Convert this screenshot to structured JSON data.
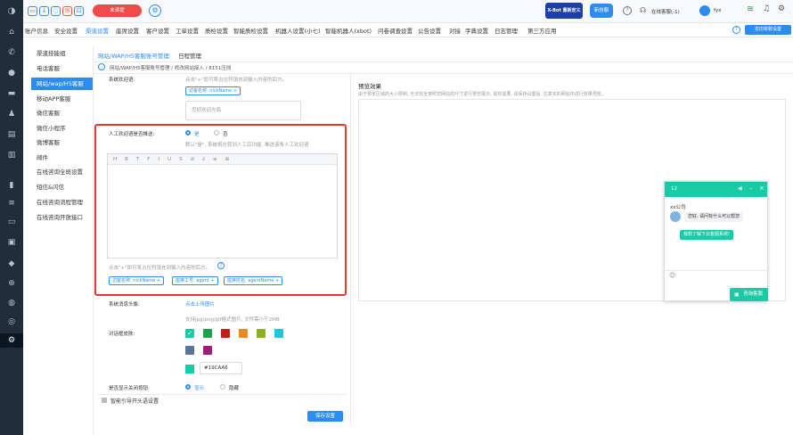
{
  "topbar": {
    "pill_button": "未读提",
    "promo_banner": "X-Bot 重新定义",
    "new_ver": "新技服",
    "status": "在线客服(-1)",
    "user": "fyx"
  },
  "nav": {
    "items": [
      "账户信息",
      "安全设置",
      "渠道设置",
      "座席设置",
      "客户设置",
      "工单设置",
      "质检设置",
      "智能质检设置",
      "机器人设置(小七)",
      "智能机器人(xbot)",
      "问卷调查设置",
      "公告设置",
      "对接",
      "字典设置",
      "日志管理",
      "第三方应用"
    ],
    "active_index": 2,
    "old_version": "去旧单致设置"
  },
  "sidebar": {
    "items": [
      "渠道技能组",
      "电话客服",
      "网站/wap/H5客服",
      "移动APP客服",
      "微信客服",
      "微信小程序",
      "微博客服",
      "邮件",
      "在线咨询全局设置",
      "短信&闪信",
      "在线咨询流程管理",
      "在线咨询开放接口"
    ],
    "active_index": 2
  },
  "tabs": [
    "网站/WAP/H5客服账号管理",
    "日程管理"
  ],
  "breadcrumb": "网站/WAP/H5客服账号管理 / 修改网站接入 / 8151压测",
  "form": {
    "greeting_label": "系统欢迎语:",
    "greeting_hint": "点击\"+\"即可将占位符填充到输入内容的后方。",
    "greeting_tag": "访客名称: nickName",
    "greeting_placeholder": "您好欢迎光临",
    "manual_label": "人工欢迎语是否推送:",
    "manual_yes": "是",
    "manual_no": "否",
    "manual_desc": "默认\"是\", 系统将在转到人工后功能, 推送该条人工欢迎语",
    "editor_hint": "点击\"+\"即可将占位符填充到输入内容的后方。",
    "tags": [
      "访客名称: nickName",
      "座席工号: agent",
      "座席姓名: agentName"
    ],
    "avatar_label": "系统消息头像:",
    "avatar_link": "点击上传图片",
    "avatar_hint": "支持jpg/png/gif格式图片, 文件需小于2MB",
    "skin_label": "对话框皮肤:",
    "skin_colors": [
      "#19CAA6",
      "#1aa34a",
      "#c0201a",
      "#e6891e",
      "#8bb21d",
      "#20c5d8",
      "#5a7598",
      "#a01a7c"
    ],
    "skin_value": "#19CAA6",
    "close_label": "是否显示关闭按钮:",
    "close_show": "显示",
    "close_hide": "隐藏",
    "section_bottom": "智能引导开头语设置",
    "save_button": "保存设置"
  },
  "preview": {
    "title": "预览效果",
    "desc": "由于预览区域的大小限制, 无法完全按照您网站的尺寸进行预览展示, 如有需要, 请保存设置后, 在真实的网站中进行效果预览。",
    "window_num": "12",
    "company": "xx公司",
    "bot_msg": "您好, 请问有什么可以帮您",
    "user_msg": "我想了解下云客服系统!",
    "consult_button": "咨询客服"
  }
}
